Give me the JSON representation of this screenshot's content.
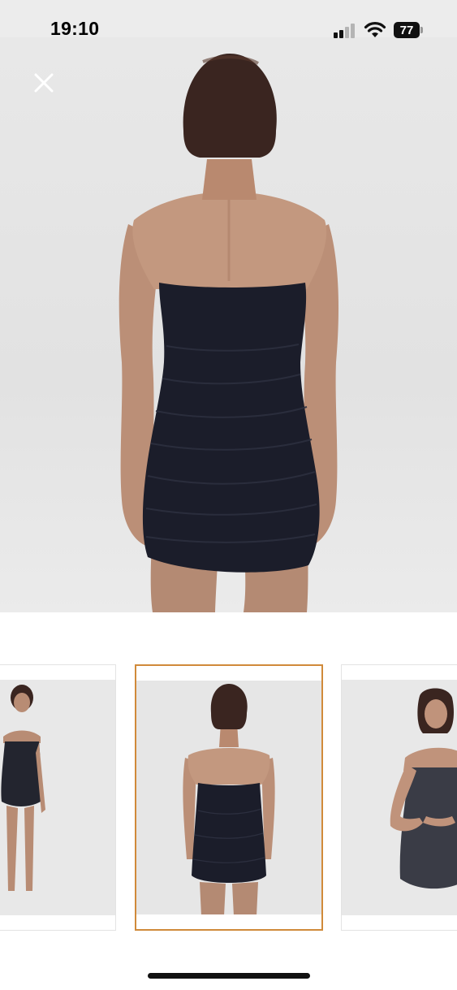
{
  "status_bar": {
    "time": "19:10",
    "battery_level": "77",
    "icons": [
      "signal-icon",
      "wifi-icon",
      "battery-icon"
    ]
  },
  "viewer": {
    "close_icon": "close-icon",
    "selected_index": 1,
    "thumbnail_count": 3
  },
  "colors": {
    "selected_border": "#d08a3a",
    "dress": "#1b1d2a",
    "background": "#e6e6e6"
  }
}
